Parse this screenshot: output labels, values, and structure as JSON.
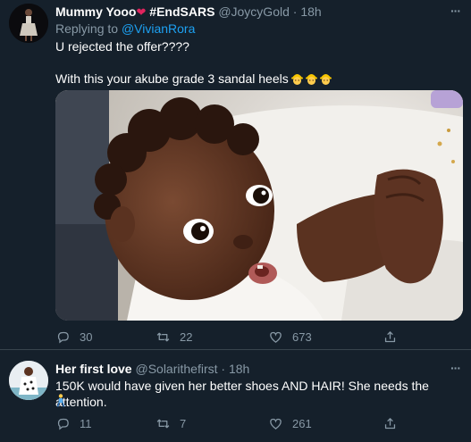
{
  "tweets": [
    {
      "name": "Mummy Yooo",
      "hashtag": "#EndSARS",
      "handle": "@JoycyGold",
      "dot": "·",
      "time": "18h",
      "replying_prefix": "Replying to",
      "replying_to": "@VivianRora",
      "text_line1": "U rejected the offer????",
      "text_line2": "With this your akube grade 3 sandal heels",
      "more": "···",
      "actions": {
        "replies": "30",
        "retweets": "22",
        "likes": "673"
      }
    },
    {
      "name": "Her first love",
      "handle": "@Solarithefirst",
      "dot": "·",
      "time": "18h",
      "text_line1": "150K would have given her better shoes AND HAIR! She needs the attention.",
      "more": "···",
      "actions": {
        "replies": "11",
        "retweets": "7",
        "likes": "261"
      }
    }
  ],
  "icons": {
    "reply": "reply-icon",
    "retweet": "retweet-icon",
    "like": "heart-icon",
    "share": "share-icon",
    "emoji": "construction-worker-emoji",
    "walker": "person-walking-emoji"
  },
  "colors": {
    "background": "#15202b",
    "secondary_text": "#8899a6",
    "link": "#1da1f2",
    "heart": "#e0245e",
    "divider": "#38444d"
  }
}
